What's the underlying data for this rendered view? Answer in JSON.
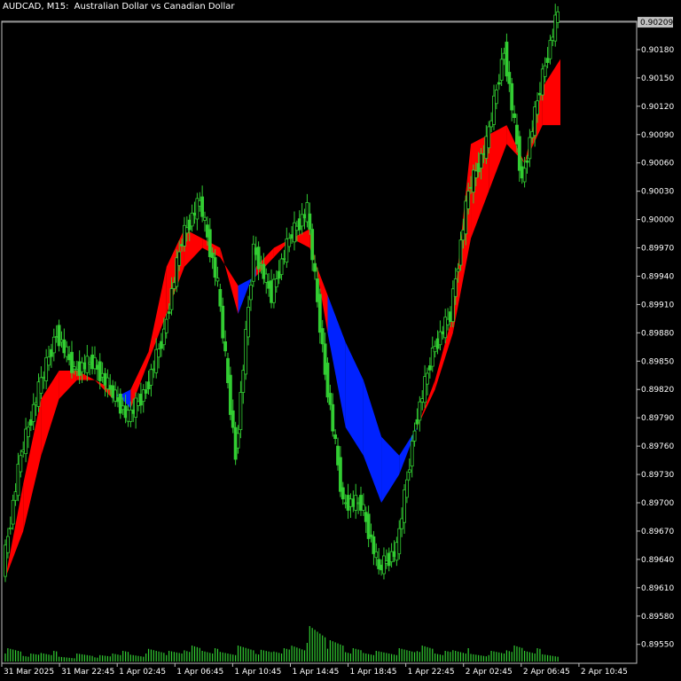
{
  "header": {
    "symbol": "AUDCAD, M15:",
    "description": "Australian Dollar vs Canadian Dollar"
  },
  "colors": {
    "background": "#000000",
    "axis": "#c0c0c0",
    "candle": "#32cd32",
    "cloud_up": "#ff0000",
    "cloud_down": "#0022ff",
    "volume": "#32cd32",
    "current_price_box": "#c0c0c0"
  },
  "price_axis": {
    "labels": [
      "0.90180",
      "0.90150",
      "0.90120",
      "0.90090",
      "0.90060",
      "0.90030",
      "0.90000",
      "0.89970",
      "0.89940",
      "0.89910",
      "0.89880",
      "0.89850",
      "0.89820",
      "0.89790",
      "0.89760",
      "0.89730",
      "0.89700",
      "0.89670",
      "0.89640",
      "0.89610",
      "0.89580",
      "0.89550"
    ],
    "current_price": "0.90209"
  },
  "time_axis": {
    "labels": [
      "31 Mar 2025",
      "31 Mar 22:45",
      "1 Apr 02:45",
      "1 Apr 06:45",
      "1 Apr 10:45",
      "1 Apr 14:45",
      "1 Apr 18:45",
      "1 Apr 22:45",
      "2 Apr 02:45",
      "2 Apr 06:45",
      "2 Apr 10:45"
    ]
  },
  "chart_data": {
    "type": "line",
    "ylim": [
      0.8953,
      0.9021
    ],
    "close": [
      0.8963,
      0.8975,
      0.8982,
      0.8988,
      0.8984,
      0.8985,
      0.8982,
      0.8979,
      0.8982,
      0.8988,
      0.8998,
      0.9002,
      0.8993,
      0.8975,
      0.8997,
      0.8992,
      0.8998,
      0.9001,
      0.8984,
      0.897,
      0.897,
      0.8963,
      0.8965,
      0.8978,
      0.8986,
      0.899,
      0.9003,
      0.9008,
      0.9018,
      0.9004,
      0.9014,
      0.9022
    ],
    "fast_ma": [
      0.8962,
      0.8972,
      0.8981,
      0.8984,
      0.8984,
      0.8983,
      0.8981,
      0.8982,
      0.8986,
      0.8995,
      0.8999,
      0.8998,
      0.8997,
      0.899,
      0.8995,
      0.8997,
      0.8998,
      0.8999,
      0.8988,
      0.8978,
      0.8975,
      0.897,
      0.8973,
      0.8978,
      0.8983,
      0.899,
      0.9008,
      0.9009,
      0.901,
      0.9006,
      0.9014,
      0.9017
    ],
    "slow_ma": [
      0.8962,
      0.8967,
      0.8975,
      0.8981,
      0.8983,
      0.8983,
      0.8982,
      0.898,
      0.8985,
      0.899,
      0.8995,
      0.8997,
      0.8996,
      0.8993,
      0.8994,
      0.8996,
      0.8998,
      0.8997,
      0.8992,
      0.8987,
      0.8983,
      0.8977,
      0.8975,
      0.8978,
      0.8982,
      0.8988,
      0.8998,
      0.9003,
      0.9008,
      0.9006,
      0.901,
      0.901
    ],
    "volume": [
      0.25,
      0.15,
      0.2,
      0.1,
      0.15,
      0.12,
      0.2,
      0.15,
      0.25,
      0.2,
      0.3,
      0.25,
      0.2,
      0.3,
      0.22,
      0.25,
      0.35,
      0.7,
      0.4,
      0.25,
      0.2,
      0.2,
      0.25,
      0.3,
      0.2,
      0.25,
      0.15,
      0.2,
      0.3,
      0.25,
      0.15,
      0.2
    ]
  }
}
